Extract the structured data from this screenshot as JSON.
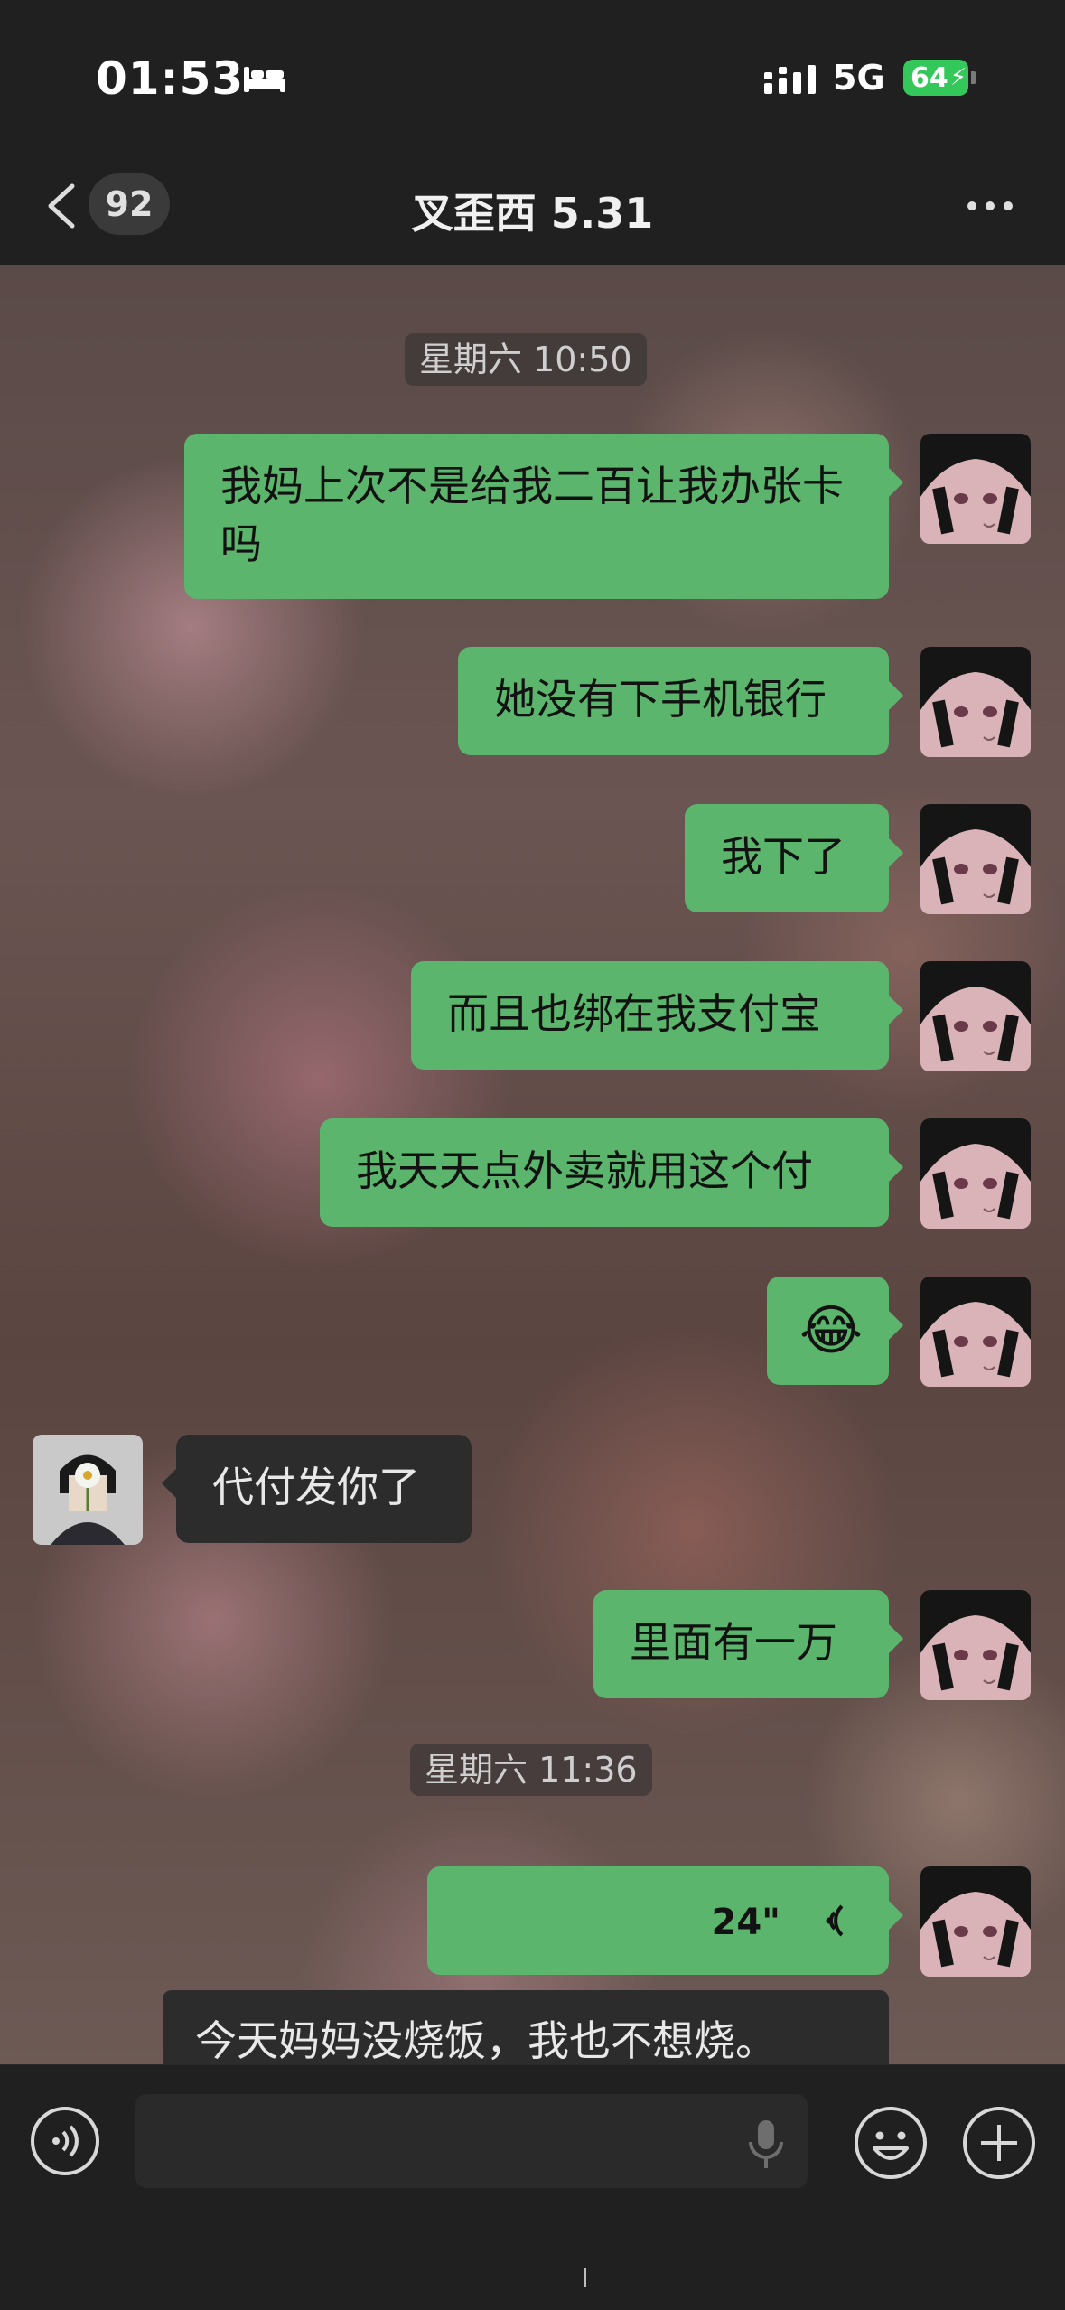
{
  "status": {
    "time": "01:53",
    "network": "5G",
    "battery": "64"
  },
  "header": {
    "unread_count": "92",
    "title": "叉歪西 5.31"
  },
  "timestamps": [
    "星期六 10:50",
    "星期六 11:36"
  ],
  "messages": [
    {
      "side": "out",
      "text": "我妈上次不是给我二百让我办张卡吗"
    },
    {
      "side": "out",
      "text": "她没有下手机银行"
    },
    {
      "side": "out",
      "text": "我下了"
    },
    {
      "side": "out",
      "text": "而且也绑在我支付宝"
    },
    {
      "side": "out",
      "text": "我天天点外卖就用这个付"
    },
    {
      "side": "out",
      "text": "😂"
    },
    {
      "side": "in",
      "text": "代付发你了"
    },
    {
      "side": "out",
      "text": "里面有一万"
    },
    {
      "side": "out",
      "type": "voice",
      "duration": "24\""
    },
    {
      "side": "in",
      "text": "今天妈妈没烧饭，我也不想烧。"
    }
  ],
  "colors": {
    "outgoing_bubble": "#5bb56c",
    "incoming_bubble": "#2c2c2c",
    "battery": "#34c759"
  }
}
